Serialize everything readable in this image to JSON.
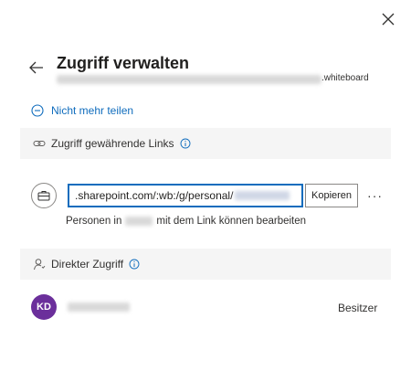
{
  "dialog": {
    "title": "Zugriff verwalten",
    "subtitle_suffix": ".whiteboard"
  },
  "actions": {
    "stop_sharing": "Nicht mehr teilen"
  },
  "links_section": {
    "heading": "Zugriff gewährende Links",
    "url_prefix": ".sharepoint.com/:wb:/g/personal/",
    "copy_label": "Kopieren",
    "more_label": "···",
    "desc_before": "Personen in",
    "desc_after": "mit dem Link können bearbeiten"
  },
  "direct_section": {
    "heading": "Direkter Zugriff",
    "person": {
      "initials": "KD",
      "role": "Besitzer"
    }
  },
  "colors": {
    "accent": "#0f6cbd",
    "avatar": "#6b2f9b",
    "section_bg": "#f5f5f5"
  },
  "icons": [
    "close-icon",
    "back-arrow-icon",
    "remove-circle-icon",
    "link-icon",
    "info-icon",
    "briefcase-icon",
    "person-icon"
  ]
}
